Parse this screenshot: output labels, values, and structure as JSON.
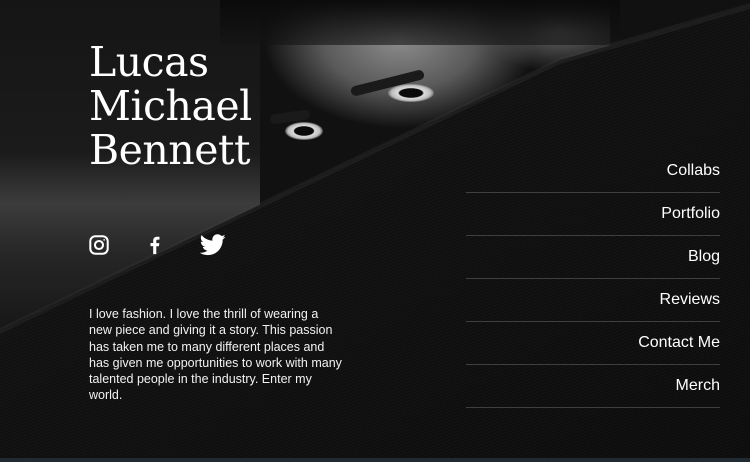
{
  "profile": {
    "name_lines": [
      "Lucas",
      "Michael",
      "Bennett"
    ],
    "about": "I love fashion. I love the thrill of wearing a new piece and giving it a story. This passion has taken me to many different places and has given me opportunities to work with many talented people in the industry. Enter my world."
  },
  "social": {
    "icons": [
      "instagram-icon",
      "facebook-icon",
      "twitter-icon"
    ]
  },
  "menu": {
    "items": [
      "Collabs",
      "Portfolio",
      "Blog",
      "Reviews",
      "Contact Me",
      "Merch"
    ]
  },
  "colors": {
    "background": "#111111",
    "text": "#ffffff",
    "divider": "#3f3f3f"
  }
}
